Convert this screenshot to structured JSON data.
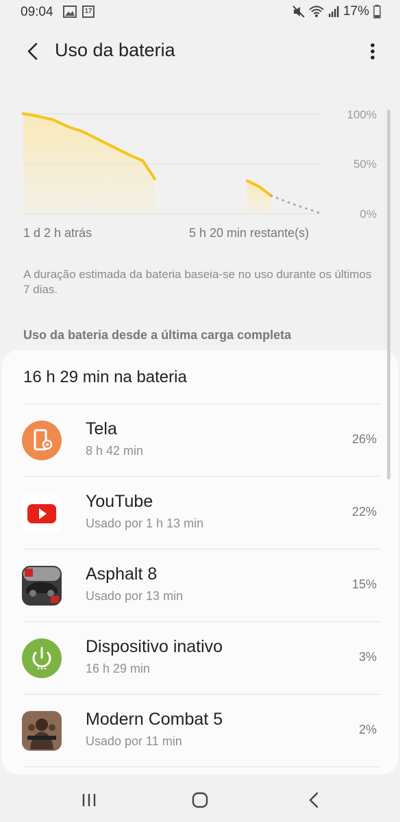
{
  "status_bar": {
    "time": "09:04",
    "calendar_badge": "17",
    "battery_percent": "17%",
    "icons": [
      "image-icon",
      "calendar-icon",
      "mute-icon",
      "wifi-icon",
      "signal-icon",
      "battery-icon"
    ]
  },
  "header": {
    "title": "Uso da bateria",
    "back_icon": "back-arrow-icon",
    "more_icon": "more-vert-icon"
  },
  "chart_data": {
    "type": "line",
    "title": "",
    "y_ticks": [
      "100%",
      "50%",
      "0%"
    ],
    "x_labels": [
      "1 d 2 h atrás",
      "5 h 20 min restante(s)"
    ],
    "ylim": [
      0,
      100
    ],
    "xlim": [
      0,
      1
    ],
    "grid": true,
    "line_color": "#f5c518",
    "fill_color": "#fbe9b3",
    "series": [
      {
        "style": "solid",
        "points": [
          [
            0,
            100
          ],
          [
            0.04,
            98
          ],
          [
            0.1,
            94
          ],
          [
            0.15,
            87
          ],
          [
            0.2,
            82
          ],
          [
            0.26,
            73
          ],
          [
            0.3,
            67
          ],
          [
            0.36,
            58
          ],
          [
            0.4,
            53
          ],
          [
            0.44,
            35
          ]
        ]
      },
      {
        "style": "solid",
        "points": [
          [
            0.75,
            33
          ],
          [
            0.79,
            27
          ],
          [
            0.83,
            18
          ]
        ]
      },
      {
        "style": "dotted",
        "color": "#aaaaaa",
        "points": [
          [
            0.83,
            18
          ],
          [
            0.9,
            10
          ],
          [
            1.0,
            0
          ]
        ]
      }
    ]
  },
  "note": "A duração estimada da bateria baseia-se no uso durante os últimos 7 dias.",
  "section_title": "Uso da bateria desde a última carga completa",
  "card": {
    "total": "16 h 29 min na bateria",
    "items": [
      {
        "name": "Tela",
        "detail": "8 h 42 min",
        "percent": "26%",
        "icon": "screen-settings-icon",
        "icon_color": "#ef8a4e"
      },
      {
        "name": "YouTube",
        "detail": "Usado por 1 h 13 min",
        "percent": "22%",
        "icon": "youtube-icon",
        "icon_color": "#e62117"
      },
      {
        "name": "Asphalt 8",
        "detail": "Usado por 13 min",
        "percent": "15%",
        "icon": "asphalt-8-icon",
        "icon_color": "#555555"
      },
      {
        "name": "Dispositivo inativo",
        "detail": "16 h 29 min",
        "percent": "3%",
        "icon": "power-icon",
        "icon_color": "#7cb342"
      },
      {
        "name": "Modern Combat 5",
        "detail": "Usado por 11 min",
        "percent": "2%",
        "icon": "modern-combat-5-icon",
        "icon_color": "#6b4a3a"
      }
    ]
  },
  "nav_bar": {
    "recent": "recent-apps-icon",
    "home": "home-icon",
    "back": "back-icon"
  }
}
